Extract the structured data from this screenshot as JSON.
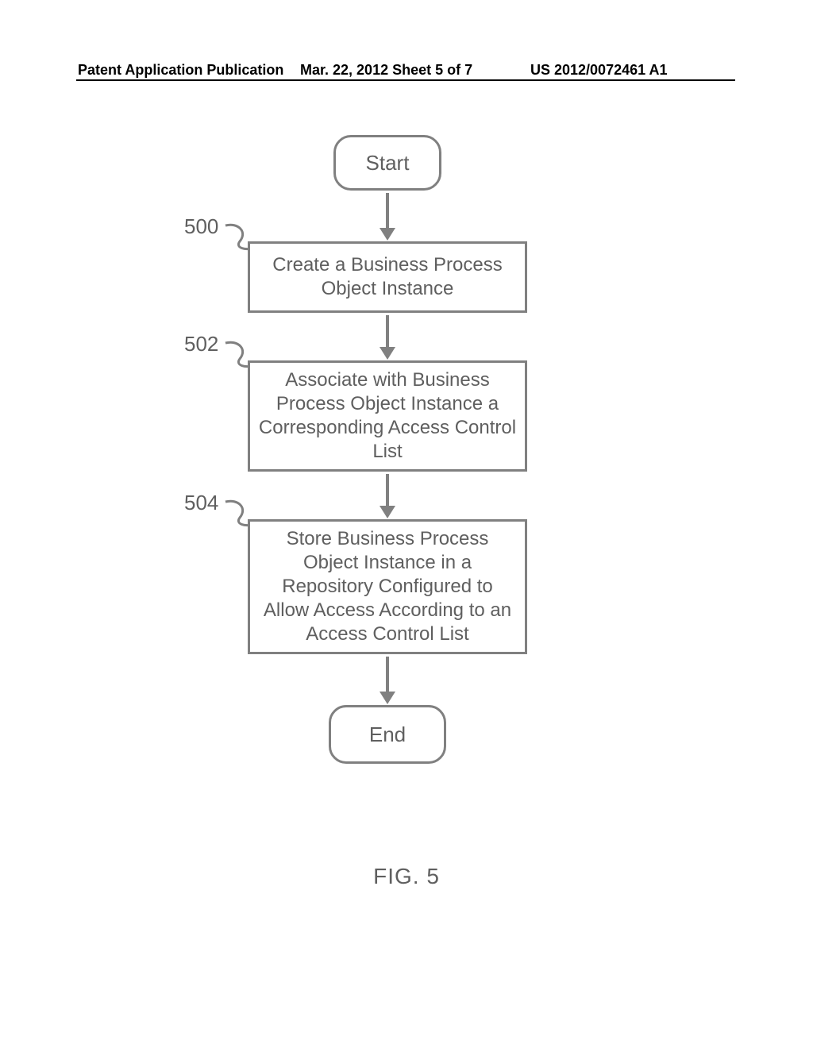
{
  "header": {
    "left": "Patent Application Publication",
    "middle": "Mar. 22, 2012  Sheet 5 of 7",
    "right": "US 2012/0072461 A1"
  },
  "flow": {
    "start": "Start",
    "end": "End",
    "steps": [
      {
        "ref": "500",
        "text": "Create a Business Process Object Instance"
      },
      {
        "ref": "502",
        "text": "Associate with Business Process Object Instance a Corresponding Access Control List"
      },
      {
        "ref": "504",
        "text": "Store Business Process Object Instance in a Repository Configured to Allow Access According to an Access Control List"
      }
    ]
  },
  "figure_caption": "FIG. 5"
}
